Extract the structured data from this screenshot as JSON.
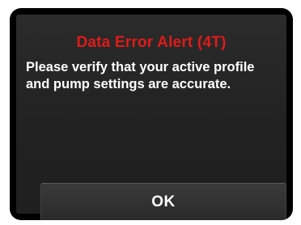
{
  "alert": {
    "title": "Data Error Alert (4T)",
    "message": "Please verify that your active profile and pump settings are accurate.",
    "title_color": "#e01a1a",
    "background_color": "#222222"
  },
  "actions": {
    "ok_label": "OK"
  }
}
